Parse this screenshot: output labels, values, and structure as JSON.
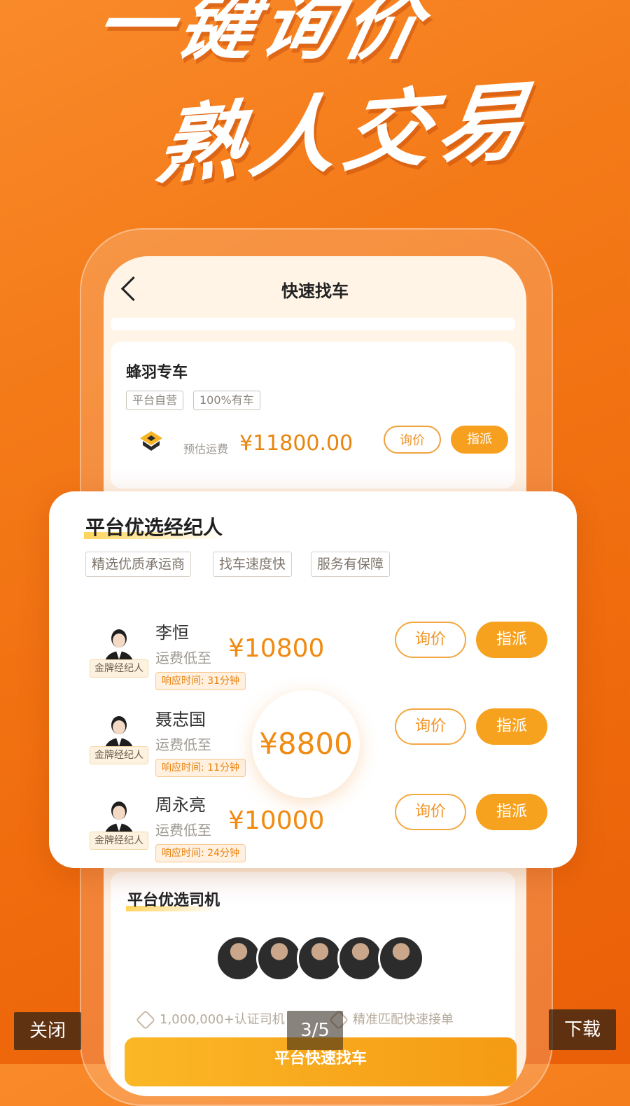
{
  "headline": {
    "line1": "一键询价",
    "line2": "熟人交易"
  },
  "phone": {
    "nav_title": "快速找车",
    "express": {
      "name": "蜂羽专车",
      "tags": [
        "平台自营",
        "100%有车"
      ],
      "est_label": "预估运费",
      "est_value": "¥11800.00",
      "ask_label": "询价",
      "assign_label": "指派"
    },
    "drivers": {
      "title": "平台优选司机",
      "stat1": "1,000,000+认证司机",
      "stat2": "精准匹配快速接单",
      "cta": "平台快速找车"
    }
  },
  "agents": {
    "title": "平台优选经纪人",
    "tags": [
      "精选优质承运商",
      "找车速度快",
      "服务有保障"
    ],
    "badge": "金牌经纪人",
    "low_label": "运费低至",
    "ask_label": "询价",
    "assign_label": "指派",
    "list": [
      {
        "name": "李恒",
        "price": "¥10800",
        "response": "响应时间: 31分钟"
      },
      {
        "name": "聂志国",
        "price": "",
        "response": "响应时间: 11分钟"
      },
      {
        "name": "周永亮",
        "price": "¥10000",
        "response": "响应时间: 24分钟"
      }
    ],
    "highlight_price": "¥8800"
  },
  "gallery": {
    "close": "关闭",
    "page": "3/5",
    "download": "下载"
  },
  "colors": {
    "brand_orange": "#f47a18",
    "accent": "#f7a21f",
    "price": "#f08a10"
  }
}
